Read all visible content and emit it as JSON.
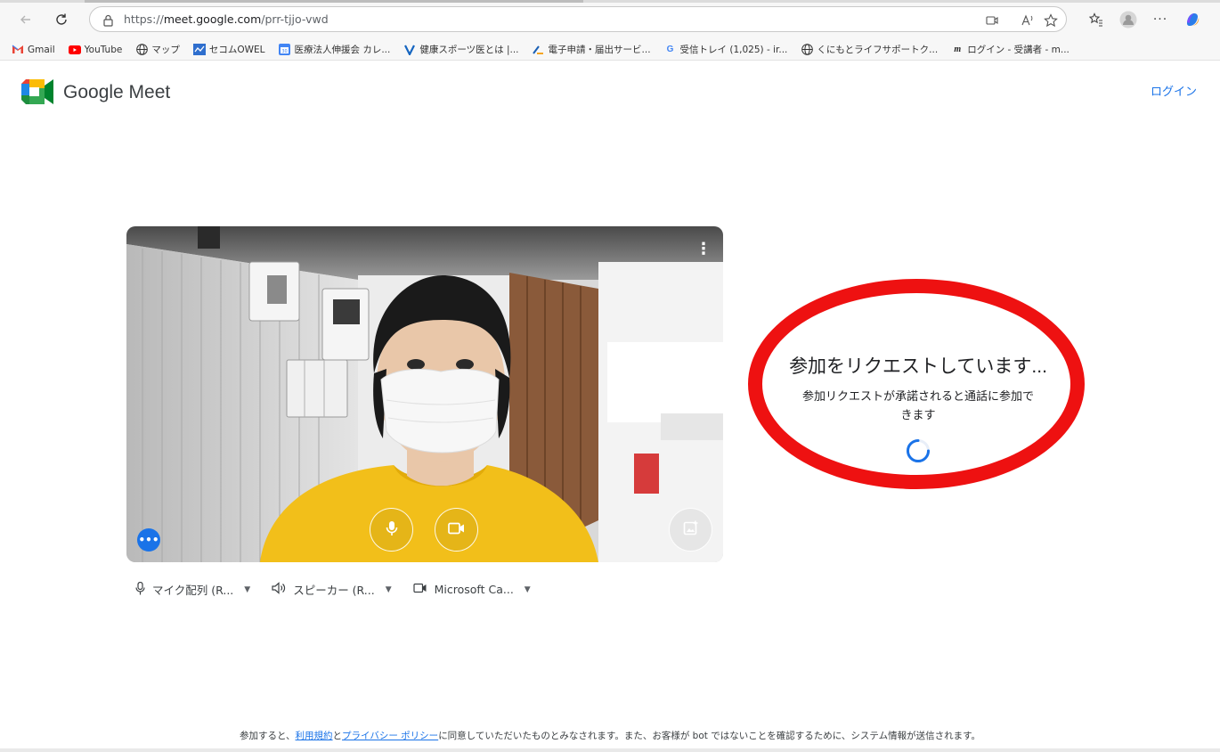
{
  "browser": {
    "url_prefix": "https://",
    "url_domain": "meet.google.com",
    "url_path": "/prr-tjjo-vwd"
  },
  "bookmarks": [
    {
      "label": "Gmail",
      "icon": "gmail-icon"
    },
    {
      "label": "YouTube",
      "icon": "youtube-icon"
    },
    {
      "label": "マップ",
      "icon": "globe-icon"
    },
    {
      "label": "セコムOWEL",
      "icon": "app-icon"
    },
    {
      "label": "医療法人伸援会 カレ...",
      "icon": "calendar-icon"
    },
    {
      "label": "健康スポーツ医とは |...",
      "icon": "v-icon"
    },
    {
      "label": "電子申請・届出サービ...",
      "icon": "e-gov-icon"
    },
    {
      "label": "受信トレイ (1,025) - ir...",
      "icon": "google-icon"
    },
    {
      "label": "くにもとライフサポートク...",
      "icon": "globe-icon"
    },
    {
      "label": "ログイン - 受講者 - m...",
      "icon": "m-icon"
    }
  ],
  "meet": {
    "app_title": "Google Meet",
    "login_label": "ログイン"
  },
  "devices": {
    "mic_label": "マイク配列 (R...",
    "speaker_label": "スピーカー (R...",
    "camera_label": "Microsoft Ca..."
  },
  "join": {
    "title": "参加をリクエストしています...",
    "subtitle": "参加リクエストが承諾されると通話に参加できます"
  },
  "footer": {
    "prefix": "参加すると、",
    "terms_link": "利用規約",
    "and": "と",
    "privacy_link": "プライバシー ポリシー",
    "suffix": "に同意していただいたものとみなされます。また、お客様が bot ではないことを確認するために、システム情報が送信されます。"
  },
  "colors": {
    "accent": "#1a73e8",
    "annotation_red": "#ee1111"
  }
}
